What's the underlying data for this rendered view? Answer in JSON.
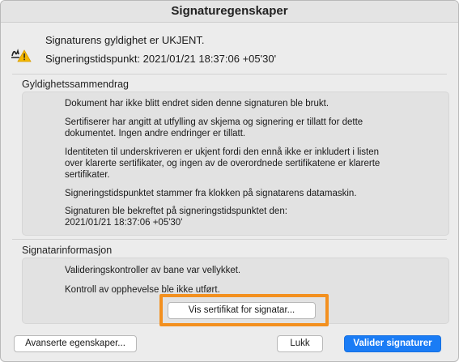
{
  "window": {
    "title": "Signaturegenskaper"
  },
  "header": {
    "status": "Signaturens gyldighet er UKJENT.",
    "timestamp": "Signeringstidspunkt: 2021/01/21 18:37:06 +05'30'",
    "icon": "signature-warning-icon"
  },
  "validity_summary": {
    "label": "Gyldighetssammendrag",
    "paragraphs": [
      "Dokument har ikke blitt endret siden denne signaturen ble brukt.",
      "Sertifiserer har angitt at utfylling av skjema og signering er tillatt for dette\ndokumentet. Ingen andre endringer er tillatt.",
      "Identiteten til underskriveren er ukjent fordi den ennå ikke er inkludert i listen\nover klarerte sertifikater, og ingen av de overordnede sertifikatene er klarerte\nsertifikater.",
      "Signeringstidspunktet stammer fra klokken på signatarens datamaskin.",
      "Signaturen ble bekreftet på signeringstidspunktet den:\n2021/01/21 18:37:06 +05'30'"
    ]
  },
  "signer_info": {
    "label": "Signatarinformasjon",
    "paragraphs": [
      "Valideringskontroller av bane var vellykket.",
      "Kontroll av opphevelse ble ikke utført."
    ],
    "show_cert_button": "Vis sertifikat for signatar..."
  },
  "footer": {
    "advanced_button": "Avanserte egenskaper...",
    "close_button": "Lukk",
    "validate_button": "Valider signaturer"
  },
  "colors": {
    "accent": "#1a7cf5",
    "highlight": "#f3901f",
    "warning": "#f5b800"
  }
}
